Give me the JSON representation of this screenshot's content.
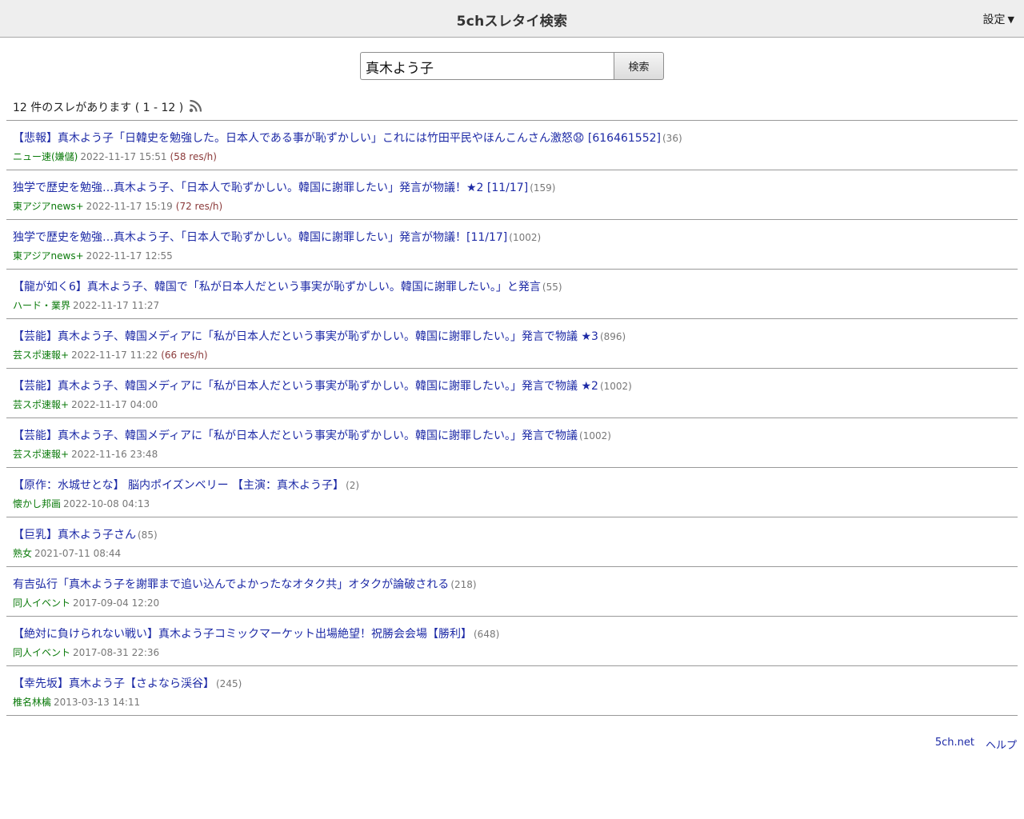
{
  "header": {
    "title": "5chスレタイ検索",
    "settings_label": "設定"
  },
  "search": {
    "query": "真木よう子",
    "button_label": "検索"
  },
  "result_summary": "12 件のスレがあります ( 1 - 12 )",
  "results": [
    {
      "title": "【悲報】真木よう子「日韓史を勉強した。日本人である事が恥ずかしい」これには竹田平民やほんこんさん激怒😧 [616461552]",
      "res": "(36)",
      "board": "ニュー速(嫌儲)",
      "date": "2022-11-17 15:51",
      "speed": "(58 res/h)"
    },
    {
      "title": "独学で歴史を勉強…真木よう子、「日本人で恥ずかしい。韓国に謝罪したい」発言が物議！★2 [11/17]",
      "res": "(159)",
      "board": "東アジアnews+",
      "date": "2022-11-17 15:19",
      "speed": "(72 res/h)"
    },
    {
      "title": "独学で歴史を勉強…真木よう子、「日本人で恥ずかしい。韓国に謝罪したい」発言が物議！[11/17]",
      "res": "(1002)",
      "board": "東アジアnews+",
      "date": "2022-11-17 12:55",
      "speed": ""
    },
    {
      "title": "【龍が如く6】真木よう子、韓国で「私が日本人だという事実が恥ずかしい。韓国に謝罪したい。」と発言",
      "res": "(55)",
      "board": "ハード・業界",
      "date": "2022-11-17 11:27",
      "speed": ""
    },
    {
      "title": "【芸能】真木よう子、韓国メディアに「私が日本人だという事実が恥ずかしい。韓国に謝罪したい。」発言で物議 ★3",
      "res": "(896)",
      "board": "芸スポ速報+",
      "date": "2022-11-17 11:22",
      "speed": "(66 res/h)"
    },
    {
      "title": "【芸能】真木よう子、韓国メディアに「私が日本人だという事実が恥ずかしい。韓国に謝罪したい。」発言で物議 ★2",
      "res": "(1002)",
      "board": "芸スポ速報+",
      "date": "2022-11-17 04:00",
      "speed": ""
    },
    {
      "title": "【芸能】真木よう子、韓国メディアに「私が日本人だという事実が恥ずかしい。韓国に謝罪したい。」発言で物議",
      "res": "(1002)",
      "board": "芸スポ速報+",
      "date": "2022-11-16 23:48",
      "speed": ""
    },
    {
      "title": "【原作：水城せとな】 脳内ポイズンベリー 【主演：真木よう子】",
      "res": "(2)",
      "board": "懐かし邦画",
      "date": "2022-10-08 04:13",
      "speed": ""
    },
    {
      "title": "【巨乳】真木よう子さん",
      "res": "(85)",
      "board": "熟女",
      "date": "2021-07-11 08:44",
      "speed": ""
    },
    {
      "title": "有吉弘行「真木よう子を謝罪まで追い込んでよかったなオタク共」オタクが論破される",
      "res": "(218)",
      "board": "同人イベント",
      "date": "2017-09-04 12:20",
      "speed": ""
    },
    {
      "title": "【絶対に負けられない戦い】真木よう子コミックマーケット出場絶望！祝勝会会場【勝利】",
      "res": "(648)",
      "board": "同人イベント",
      "date": "2017-08-31 22:36",
      "speed": ""
    },
    {
      "title": "【幸先坂】真木よう子【さよなら渓谷】",
      "res": "(245)",
      "board": "椎名林檎",
      "date": "2013-03-13 14:11",
      "speed": ""
    }
  ],
  "footer": {
    "link1": "5ch.net",
    "link2": "ヘルプ"
  },
  "icons": {
    "rss": "rss-feed-icon",
    "settings_caret": "caret-down-icon"
  }
}
